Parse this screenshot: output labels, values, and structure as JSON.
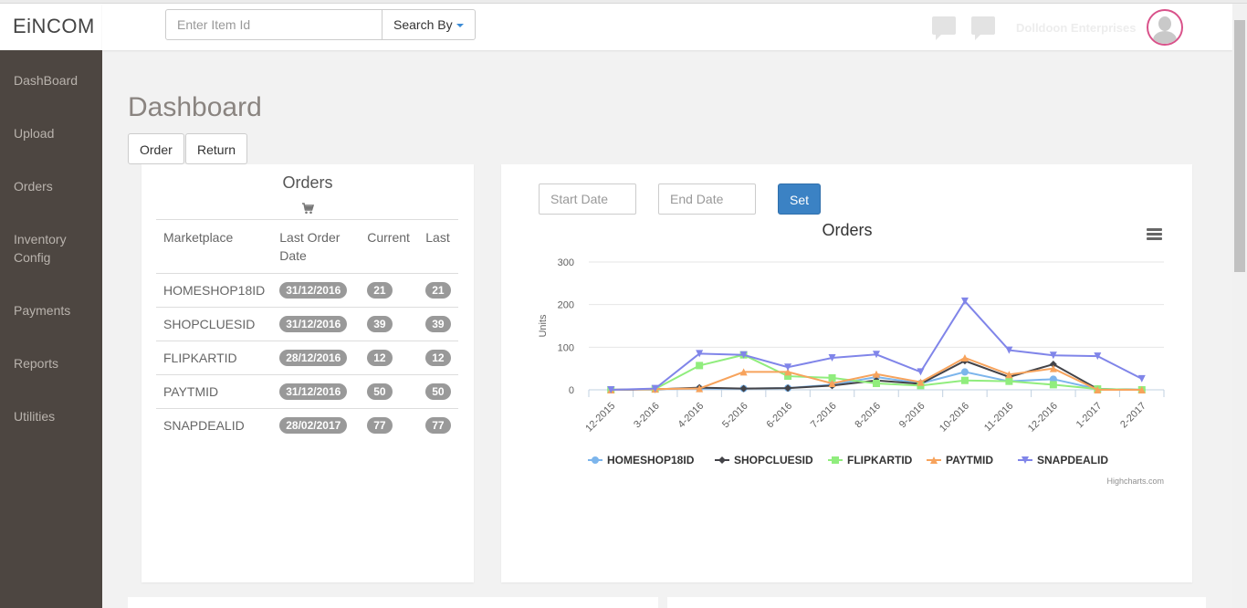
{
  "app": {
    "logo": "EiNCOM"
  },
  "sidebar": {
    "items": [
      {
        "label": "DashBoard"
      },
      {
        "label": "Upload"
      },
      {
        "label": "Orders"
      },
      {
        "label": "Inventory Config"
      },
      {
        "label": "Payments"
      },
      {
        "label": "Reports"
      },
      {
        "label": "Utilities"
      }
    ]
  },
  "header": {
    "search_placeholder": "Enter Item Id",
    "search_by_label": "Search By",
    "company_name": "Dolldoon Enterprises"
  },
  "main": {
    "title": "Dashboard",
    "tabs": [
      {
        "label": "Order"
      },
      {
        "label": "Return"
      }
    ]
  },
  "orders_panel": {
    "title": "Orders",
    "icon": "cart-icon",
    "columns": [
      "Marketplace",
      "Last Order Date",
      "Current",
      "Last"
    ],
    "rows": [
      {
        "marketplace": "HOMESHOP18ID",
        "date": "31/12/2016",
        "current": "21",
        "last": "21"
      },
      {
        "marketplace": "SHOPCLUESID",
        "date": "31/12/2016",
        "current": "39",
        "last": "39"
      },
      {
        "marketplace": "FLIPKARTID",
        "date": "28/12/2016",
        "current": "12",
        "last": "12"
      },
      {
        "marketplace": "PAYTMID",
        "date": "31/12/2016",
        "current": "50",
        "last": "50"
      },
      {
        "marketplace": "SNAPDEALID",
        "date": "28/02/2017",
        "current": "77",
        "last": "77"
      }
    ]
  },
  "chart_panel": {
    "start_placeholder": "Start Date",
    "end_placeholder": "End Date",
    "set_label": "Set",
    "credit": "Highcharts.com"
  },
  "chart_data": {
    "type": "line",
    "title": "Orders",
    "xlabel": "",
    "ylabel": "Units",
    "ylim": [
      0,
      300
    ],
    "yticks": [
      0,
      100,
      200,
      300
    ],
    "grid": true,
    "legend": "bottom",
    "categories": [
      "12-2015",
      "3-2016",
      "4-2016",
      "5-2016",
      "6-2016",
      "7-2016",
      "8-2016",
      "9-2016",
      "10-2016",
      "11-2016",
      "12-2016",
      "1-2017",
      "2-2017"
    ],
    "series": [
      {
        "name": "HOMESHOP18ID",
        "color": "#7cb5ec",
        "marker": "circle",
        "values": [
          0,
          2,
          3,
          3,
          4,
          12,
          30,
          15,
          42,
          20,
          25,
          2,
          0
        ]
      },
      {
        "name": "SHOPCLUESID",
        "color": "#434348",
        "marker": "diamond",
        "values": [
          0,
          1,
          5,
          3,
          4,
          10,
          22,
          14,
          68,
          30,
          60,
          2,
          0
        ]
      },
      {
        "name": "FLIPKARTID",
        "color": "#90ed7d",
        "marker": "square",
        "values": [
          0,
          2,
          57,
          82,
          32,
          28,
          15,
          10,
          22,
          20,
          12,
          2,
          0
        ]
      },
      {
        "name": "PAYTMID",
        "color": "#f7a35c",
        "marker": "triangle",
        "values": [
          0,
          2,
          3,
          42,
          42,
          15,
          37,
          18,
          75,
          36,
          50,
          0,
          0
        ]
      },
      {
        "name": "SNAPDEALID",
        "color": "#8085e9",
        "marker": "triangle-down",
        "values": [
          0,
          3,
          85,
          82,
          53,
          75,
          83,
          42,
          208,
          93,
          81,
          79,
          26
        ]
      }
    ]
  }
}
